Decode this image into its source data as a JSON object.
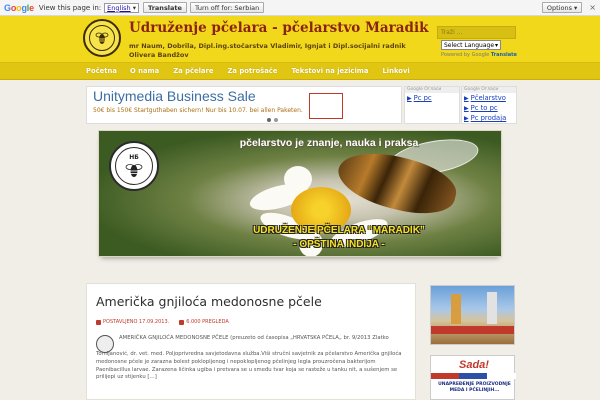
{
  "translate_bar": {
    "logo": "Google",
    "view_text": "View this page in:",
    "language": "English",
    "translate_btn": "Translate",
    "turn_off_btn": "Turn off for: Serbian",
    "options_btn": "Options ▾",
    "close": "×"
  },
  "header": {
    "title": "Udruženje pčelara - pčelarstvo Maradik",
    "description": "mr Naum, Dobrila, Dipl.ing.stočarstva Vladimir, Ignjat i Dipl.socijalni radnik Olivera Bandžov",
    "search_placeholder": "Traži ...",
    "lang_select": "Select Language",
    "powered_by": "Powered by",
    "powered_google": "Google",
    "powered_translate": "Translate"
  },
  "nav": {
    "items": [
      "Početna",
      "O nama",
      "Za pčelare",
      "Za potrošače",
      "Tekstovi na jezicima",
      "Linkovi"
    ]
  },
  "ad": {
    "title": "Unitymedia Business Sale",
    "sub": "50€ bis 150€ Startguthaben sichern! Nur bis 10.07. bei allen Paketen."
  },
  "ad_left": {
    "label": "Google Oгласи",
    "links": [
      "Pc pc"
    ]
  },
  "ad_right": {
    "label": "Google Oгласи",
    "links": [
      "Pčelarstvo",
      "Pc to pc",
      "Pc prodaja"
    ]
  },
  "hero": {
    "logo_text": "НБ",
    "slogan": "pčelarstvo je znanje, nauka i praksa",
    "org_line1": "UDRUŽENJE PČELARA “MARADIK”",
    "org_line2": "- OPŠTINA INDIJA -"
  },
  "post": {
    "title": "Američka gnjiloća medonosne pčele",
    "date": "POSTAVLJENO 17.09.2013.",
    "views": "6.000 PREGLEDA",
    "excerpt_1": "AMERIČKA GNJILOĆA MEDONOSNE PČELE (preuzeto od časopisa „HRVATSKA PČELA„ br. 9/2013 Zlatko",
    "excerpt_2": "Tomljanović, dr. vet. med. Poljoprivredna savjetodavna služba.Viši stručni savjetnik za pčelarstvo Američka gnjiloća medonosne pčele je zarazna bolest poklopljenog i nepoklopljenog pčelinjeg legla prouzročena bakterijom Paenibacillus larvae. Zarazena ličinka ugiba i pretvara se u smeđu tvar koja se rasteže u tanku nit, a sušenjem se prilijepi uz stijenku […]"
  },
  "sidebar": {
    "promo_logo": "Sada!",
    "promo_text": "UNAPREĐENJE PROIZVODNJE MEDA I PČELINJIH..."
  },
  "colors": {
    "header_yellow": "#f2d81a",
    "title_red": "#8a2313",
    "meta_red": "#c0392b",
    "link_blue": "#1a3fbd"
  }
}
